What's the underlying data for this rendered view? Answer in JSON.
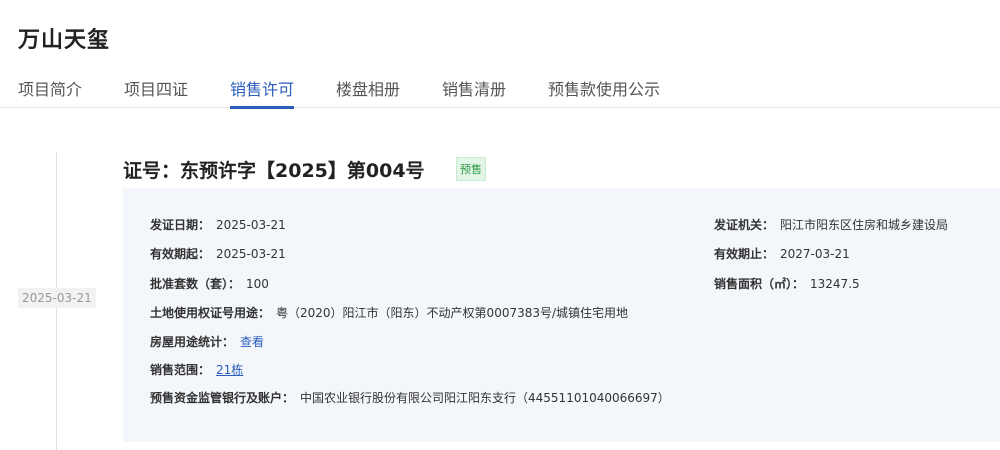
{
  "project": {
    "title": "万山天玺"
  },
  "tabs": [
    {
      "label": "项目简介"
    },
    {
      "label": "项目四证"
    },
    {
      "label": "销售许可"
    },
    {
      "label": "楼盘相册"
    },
    {
      "label": "销售清册"
    },
    {
      "label": "预售款使用公示"
    }
  ],
  "timeline": {
    "date": "2025-03-21"
  },
  "permit": {
    "title": "证号：东预许字【2025】第004号",
    "badge": "预售",
    "issue_date_label": "发证日期：",
    "issue_date": "2025-03-21",
    "authority_label": "发证机关：",
    "authority": "阳江市阳东区住房和城乡建设局",
    "valid_from_label": "有效期起：",
    "valid_from": "2025-03-21",
    "valid_to_label": "有效期止：",
    "valid_to": "2027-03-21",
    "units_label": "批准套数（套）：",
    "units": "100",
    "area_label": "销售面积（㎡）：",
    "area": "13247.5",
    "land_label": "土地使用权证号用途：",
    "land": "粤（2020）阳江市（阳东）不动产权第0007383号/城镇住宅用地",
    "usage_label": "房屋用途统计：",
    "usage_link": "查看",
    "scope_label": "销售范围：",
    "scope_link": "21栋",
    "bank_label": "预售资金监管银行及账户：",
    "bank": "中国农业银行股份有限公司阳江阳东支行（44551101040066697）"
  }
}
